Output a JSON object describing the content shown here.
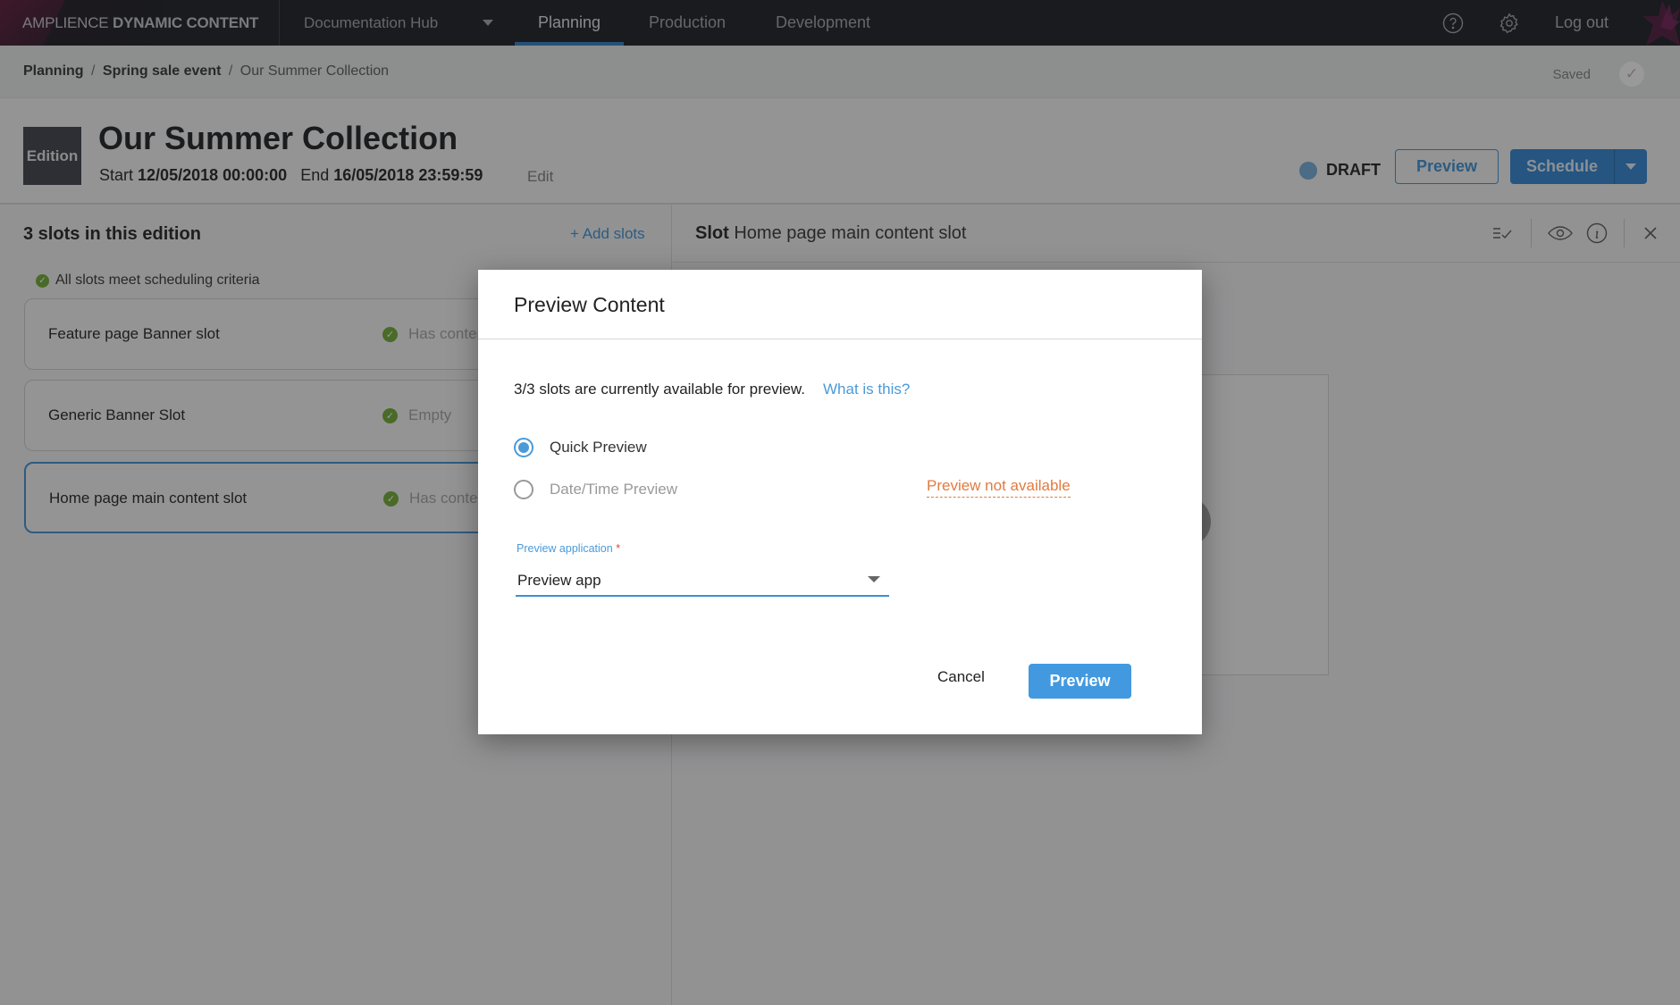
{
  "topbar": {
    "brand_light": "AMPLIENCE",
    "brand_bold": "DYNAMIC CONTENT",
    "hub": "Documentation Hub",
    "tabs": [
      {
        "label": "Planning",
        "active": true
      },
      {
        "label": "Production",
        "active": false
      },
      {
        "label": "Development",
        "active": false
      }
    ],
    "help_icon": "help-icon",
    "settings_icon": "gear-icon",
    "logout": "Log out"
  },
  "breadcrumb": {
    "items": [
      "Planning",
      "Spring sale event"
    ],
    "current": "Our Summer Collection",
    "separator": "/",
    "saved": "Saved"
  },
  "header": {
    "badge": "Edition",
    "title": "Our Summer Collection",
    "start_label": "Start",
    "start_value": "12/05/2018 00:00:00",
    "end_label": "End",
    "end_value": "16/05/2018 23:59:59",
    "edit": "Edit",
    "status": "DRAFT",
    "preview_button": "Preview",
    "schedule_button": "Schedule"
  },
  "left_panel": {
    "title": "3 slots in this edition",
    "add_slots": "+ Add slots",
    "criteria": "All slots meet scheduling criteria",
    "slots": [
      {
        "name": "Feature page Banner slot",
        "status": "Has content",
        "selected": false
      },
      {
        "name": "Generic Banner Slot",
        "status": "Empty",
        "selected": false
      },
      {
        "name": "Home page main content slot",
        "status": "Has content",
        "selected": true
      }
    ]
  },
  "right_panel": {
    "slot_label": "Slot",
    "slot_name": "Home page main content slot"
  },
  "modal": {
    "title": "Preview Content",
    "availability": "3/3 slots are currently available for preview.",
    "what_is_this": "What is this?",
    "options": [
      {
        "label": "Quick Preview",
        "checked": true,
        "disabled": false
      },
      {
        "label": "Date/Time Preview",
        "checked": false,
        "disabled": true
      }
    ],
    "not_available": "Preview not available",
    "field_label": "Preview application",
    "required_mark": "*",
    "selected_app": "Preview app",
    "cancel": "Cancel",
    "preview": "Preview"
  },
  "colors": {
    "accent": "#4299df",
    "warning": "#e27a3f",
    "success": "#7cb342",
    "topbar": "#2a2d33"
  }
}
